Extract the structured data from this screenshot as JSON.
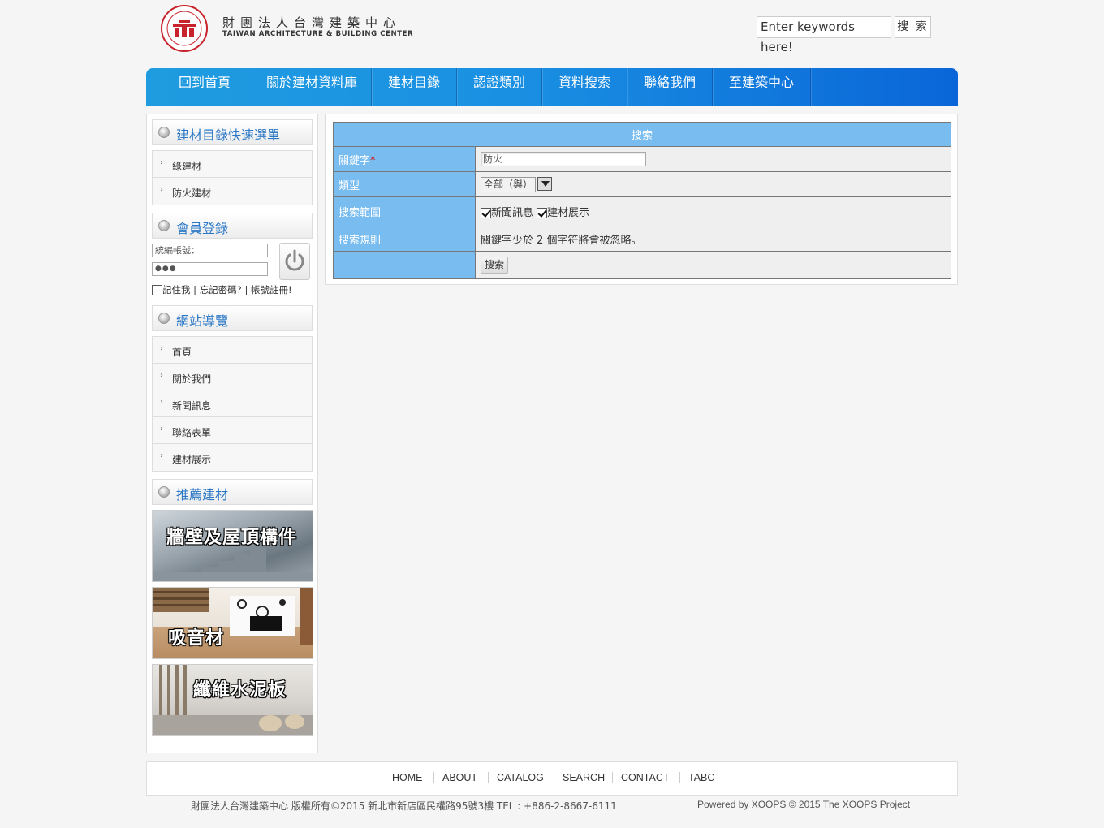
{
  "header": {
    "org_name_cn": "財團法人台灣建築中心",
    "org_name_en": "TAIWAN ARCHITECTURE & BUILDING CENTER",
    "search_placeholder": "Enter keywords here!",
    "search_button": "搜 索"
  },
  "nav": {
    "items": [
      "回到首頁",
      "關於建材資料庫",
      "建材目錄",
      "認證類別",
      "資料搜索",
      "聯絡我們",
      "至建築中心"
    ]
  },
  "sidebar": {
    "quick_menu_title": "建材目錄快速選單",
    "quick_menu_items": [
      "綠建材",
      "防火建材"
    ],
    "login_title": "會員登錄",
    "login_username_placeholder": "統編帳號：",
    "login_password_value": "●●●",
    "remember_me": "記住我",
    "forgot_password": "忘記密碼?",
    "register": "帳號註冊!",
    "sitenav_title": "網站導覽",
    "sitenav_items": [
      "首頁",
      "關於我們",
      "新聞訊息",
      "聯絡表單",
      "建材展示"
    ],
    "recommend_title": "推薦建材",
    "recommend_banners": [
      "牆壁及屋頂構件",
      "吸音材",
      "纖維水泥板"
    ]
  },
  "search_form": {
    "title": "搜索",
    "keyword_label": "關鍵字",
    "required_mark": "*",
    "keyword_value": "防火",
    "type_label": "類型",
    "type_value": "全部（與）",
    "scope_label": "搜索範圍",
    "scope_news": "新聞訊息",
    "scope_news_checked": true,
    "scope_materials": "建材展示",
    "scope_materials_checked": true,
    "rules_label": "搜索規則",
    "rules_text": "關鍵字少於 2 個字符將會被忽略。",
    "submit_label": "搜索"
  },
  "footer": {
    "nav": [
      "HOME",
      "ABOUT",
      "CATALOG",
      "SEARCH",
      "CONTACT",
      "TABC"
    ],
    "copyright": "財團法人台灣建築中心 版權所有©2015 新北市新店區民權路95號3樓 TEL : +886-2-8667-6111",
    "powered_by": "Powered by XOOPS © 2015 The XOOPS Project"
  },
  "colors": {
    "nav_gradient_start": "#1f9ce0",
    "nav_gradient_end": "#0a66d8",
    "form_label_bg": "#78bcf0",
    "block_title_text": "#2a77c6",
    "logo_red": "#c8232c"
  }
}
